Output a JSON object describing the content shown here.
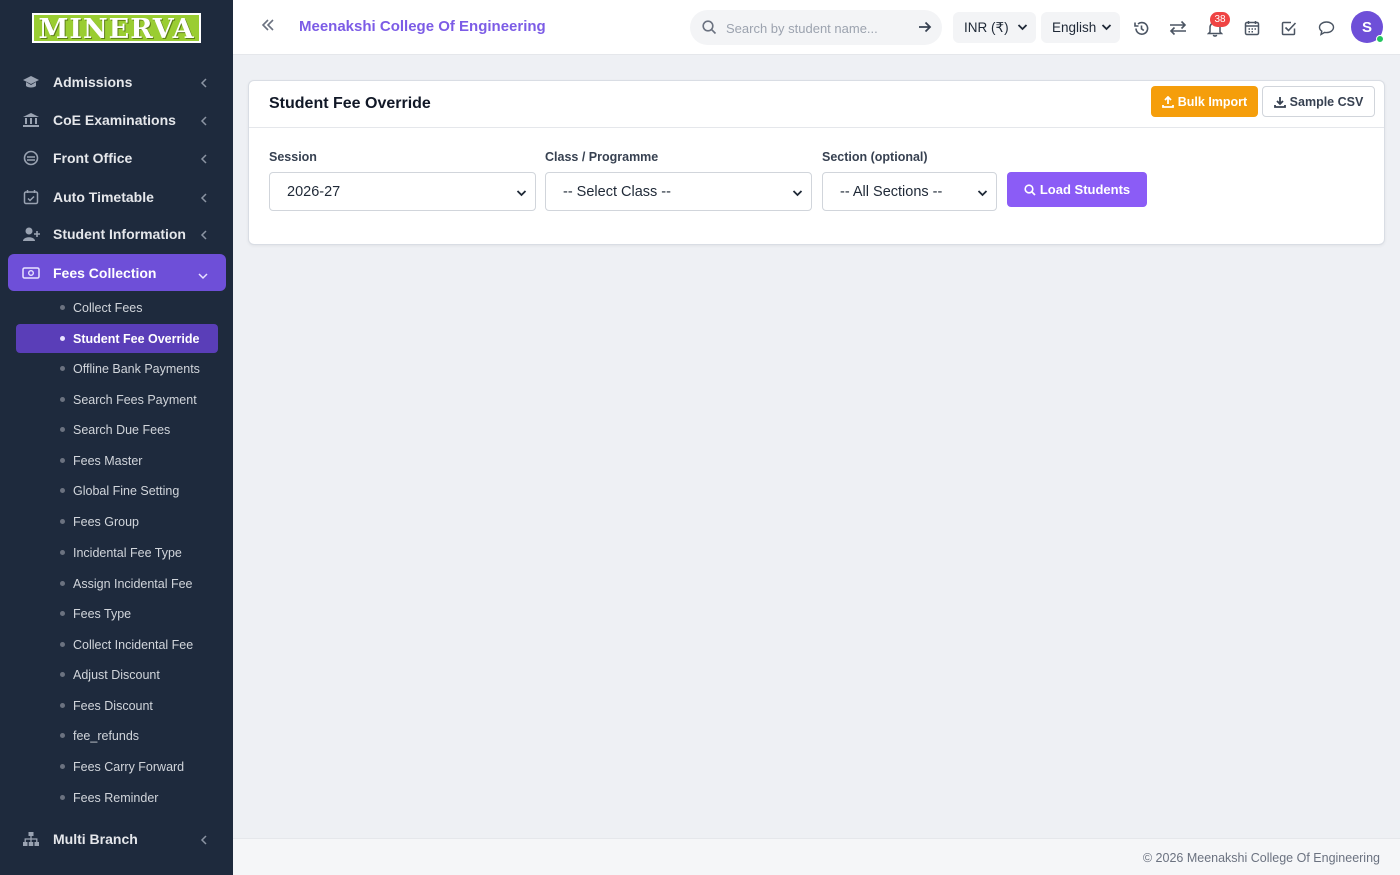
{
  "brand": {
    "logo_text": "MINERVA",
    "logo_color": "#9acd32"
  },
  "sidebar": {
    "items": [
      {
        "label": "Admissions",
        "icon": "graduation-cap-icon"
      },
      {
        "label": "CoE Examinations",
        "icon": "institution-icon"
      },
      {
        "label": "Front Office",
        "icon": "front-office-icon"
      },
      {
        "label": "Auto Timetable",
        "icon": "calendar-check-icon"
      },
      {
        "label": "Student Information",
        "icon": "user-plus-icon"
      },
      {
        "label": "Fees Collection",
        "icon": "money-bill-icon",
        "active": true
      },
      {
        "label": "Multi Branch",
        "icon": "sitemap-icon"
      }
    ],
    "fees_submenu": [
      "Collect Fees",
      "Student Fee Override",
      "Offline Bank Payments",
      "Search Fees Payment",
      "Search Due Fees",
      "Fees Master",
      "Global Fine Setting",
      "Fees Group",
      "Incidental Fee Type",
      "Assign Incidental Fee",
      "Fees Type",
      "Collect Incidental Fee",
      "Adjust Discount",
      "Fees Discount",
      "fee_refunds",
      "Fees Carry Forward",
      "Fees Reminder"
    ],
    "active_submenu": "Student Fee Override"
  },
  "header": {
    "college_name": "Meenakshi College Of Engineering",
    "search_placeholder": "Search by student name...",
    "currency": "INR (₹)",
    "language": "English",
    "notification_count": "38",
    "avatar_initial": "S"
  },
  "card": {
    "title": "Student Fee Override",
    "bulk_import_label": "Bulk Import",
    "sample_csv_label": "Sample CSV",
    "session": {
      "label": "Session",
      "value": "2026-27"
    },
    "class": {
      "label": "Class / Programme",
      "value": "-- Select Class --"
    },
    "section": {
      "label": "Section (optional)",
      "value": "-- All Sections --"
    },
    "load_label": "Load Students"
  },
  "footer": {
    "text": "© 2026 Meenakshi College Of Engineering"
  },
  "colors": {
    "accent": "#6e4fd8",
    "bulk": "#f59e0b",
    "load": "#8b5cf6",
    "sidebar_bg": "#1e2a3d"
  }
}
